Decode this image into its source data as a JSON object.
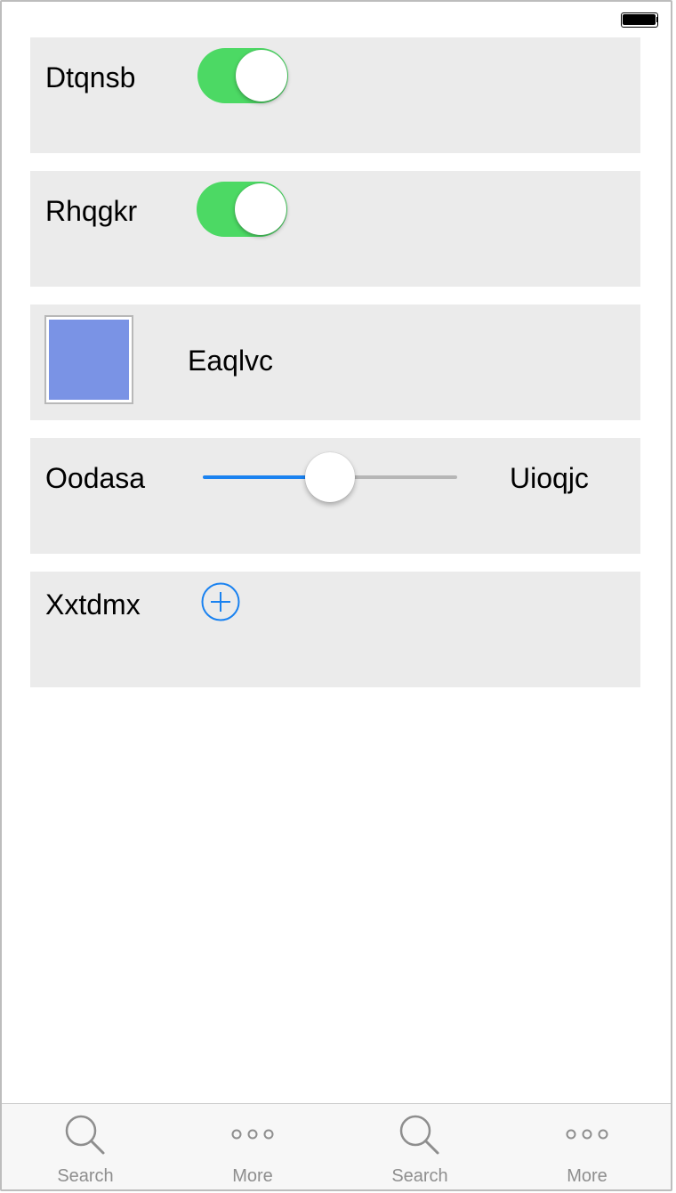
{
  "status_bar": {
    "battery_icon": "battery-full-icon"
  },
  "rows": {
    "row1": {
      "label": "Dtqnsb",
      "toggle_on": true
    },
    "row2": {
      "label": "Rhqgkr",
      "toggle_on": true
    },
    "row3": {
      "label": "Eaqlvc",
      "swatch_color": "#7a93e5"
    },
    "row4": {
      "label_left": "Oodasa",
      "label_right": "Uioqjc",
      "slider_value": 0.5
    },
    "row5": {
      "label": "Xxtdmx",
      "button_icon": "plus-circle-icon"
    }
  },
  "tabs": [
    {
      "label": "Search",
      "icon": "search-icon"
    },
    {
      "label": "More",
      "icon": "more-icon"
    },
    {
      "label": "Search",
      "icon": "search-icon"
    },
    {
      "label": "More",
      "icon": "more-icon"
    }
  ],
  "colors": {
    "toggle_on": "#4cd964",
    "accent": "#1a82f0",
    "card_bg": "#ebebeb",
    "tab_inactive": "#8e8e8e"
  }
}
